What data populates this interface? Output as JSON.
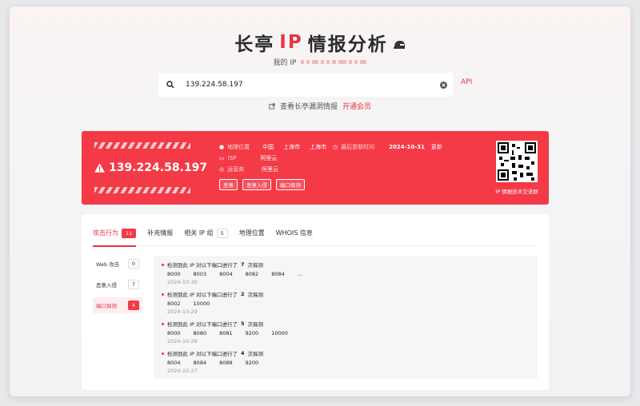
{
  "header": {
    "title_prefix": "长亭",
    "title_ip": "IP",
    "title_suffix": "情报分析",
    "my_ip_label": "我的 IP"
  },
  "search": {
    "value": "139.224.58.197",
    "placeholder": "",
    "api_label": "API"
  },
  "links": {
    "vuln_intel": "查看长亭漏洞情报",
    "member": "开通会员"
  },
  "summary": {
    "ip": "139.224.58.197",
    "location_label": "地理位置",
    "location_values": [
      "中国",
      "上海市",
      "上海市"
    ],
    "isp_label": "ISP",
    "isp_value": "阿里云",
    "operator_label": "运营商",
    "operator_value": "阿里云",
    "updated_label": "最后更新时间",
    "updated_value": "2024-10-31",
    "update_action": "更新",
    "tags": [
      "恶意",
      "恶意入侵",
      "端口探测"
    ],
    "qr_caption": "IP 情报技术交流群",
    "accent_color": "#f43a47"
  },
  "tabs": [
    {
      "label": "攻击行为",
      "count": "11"
    },
    {
      "label": "补充情报",
      "count": ""
    },
    {
      "label": "相关 IP 组",
      "count": "5"
    },
    {
      "label": "地理位置",
      "count": ""
    },
    {
      "label": "WHOIS 信息",
      "count": ""
    }
  ],
  "categories": [
    {
      "label": "Web 攻击",
      "count": "0"
    },
    {
      "label": "恶意入侵",
      "count": "7"
    },
    {
      "label": "端口探测",
      "count": "4"
    }
  ],
  "events": [
    {
      "prefix": "检测到此 IP 对以下端口进行了",
      "count": "7",
      "suffix": "次探测",
      "ports": [
        "8000",
        "8003",
        "8004",
        "8082",
        "8084",
        "..."
      ],
      "date": "2024-10-30"
    },
    {
      "prefix": "检测到此 IP 对以下端口进行了",
      "count": "2",
      "suffix": "次探测",
      "ports": [
        "8002",
        "10000"
      ],
      "date": "2024-10-29"
    },
    {
      "prefix": "检测到此 IP 对以下端口进行了",
      "count": "5",
      "suffix": "次探测",
      "ports": [
        "8000",
        "8080",
        "8081",
        "9200",
        "10000"
      ],
      "date": "2024-10-28"
    },
    {
      "prefix": "检测到此 IP 对以下端口进行了",
      "count": "4",
      "suffix": "次探测",
      "ports": [
        "8004",
        "8084",
        "8088",
        "9200"
      ],
      "date": "2024-10-27"
    }
  ]
}
